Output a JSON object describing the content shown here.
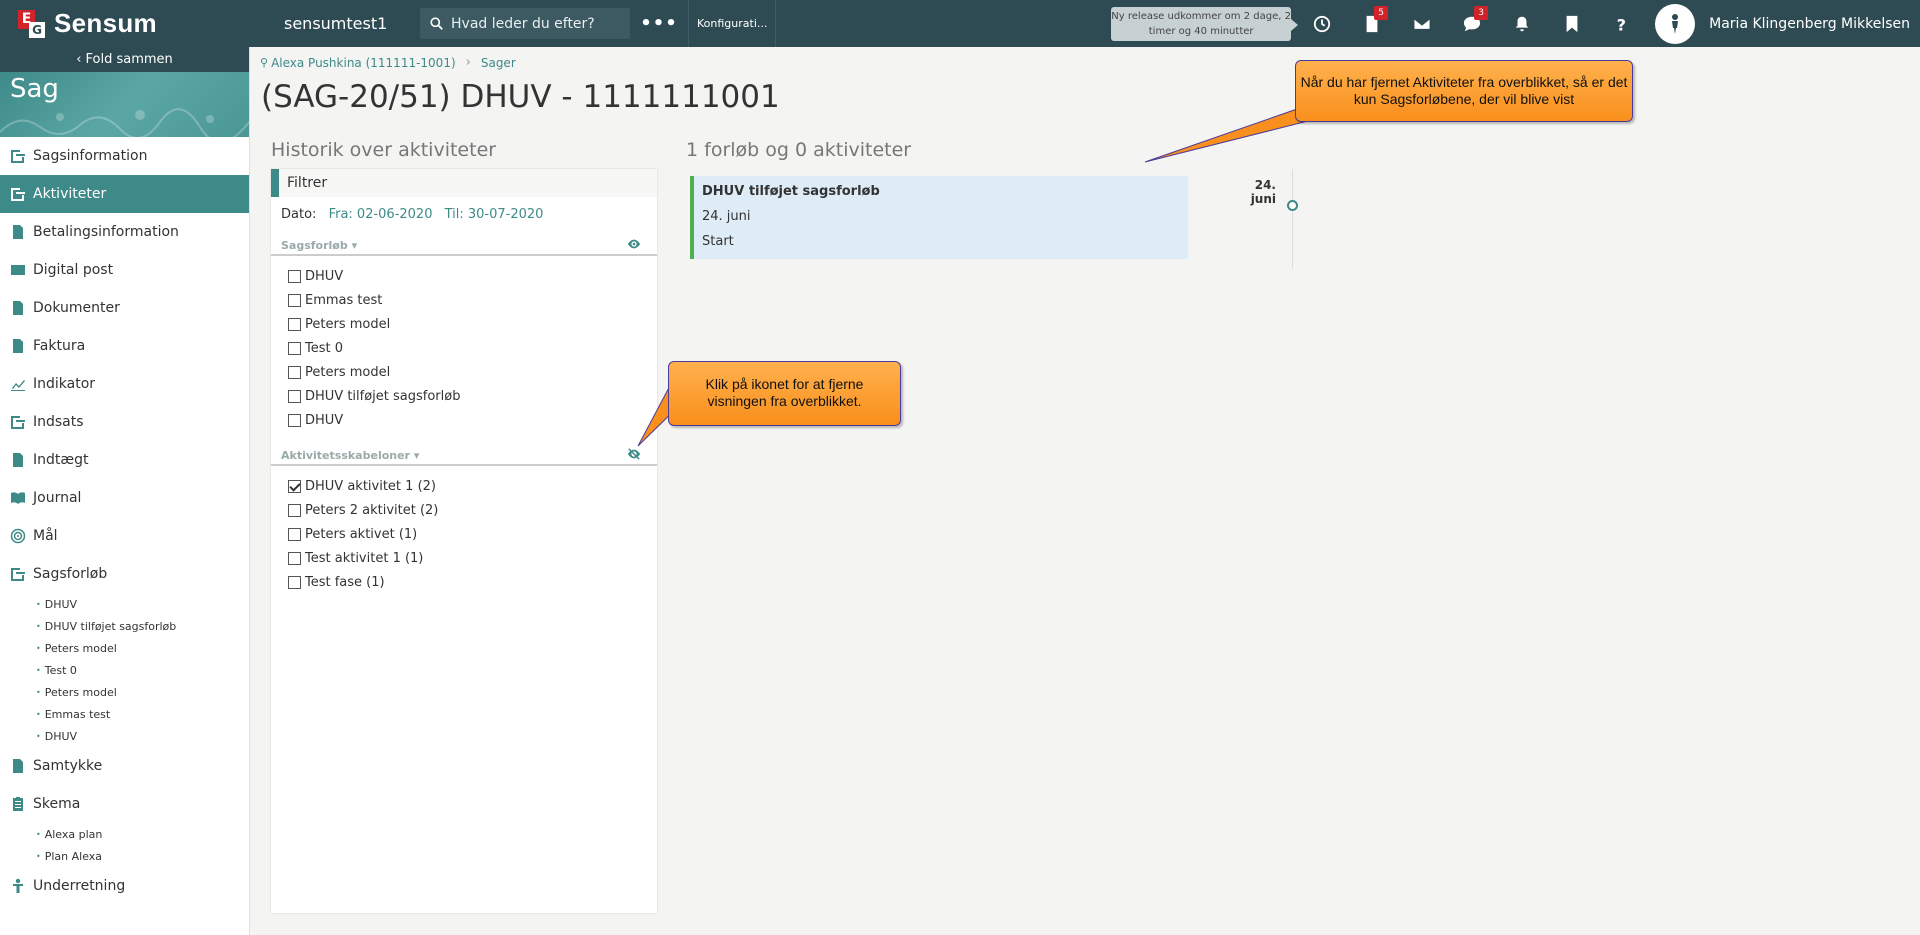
{
  "topbar": {
    "logo_e": "E",
    "logo_g": "G",
    "brand": "Sensum",
    "org": "sensumtest1",
    "search_placeholder": "Hvad leder du efter?",
    "more": "•••",
    "config": "Konfigurati...",
    "release": "Ny release udkommer om 2 dage, 2 timer og 40 minutter",
    "doc_badge": "5",
    "chat_badge": "3",
    "user": "Maria Klingenberg Mikkelsen"
  },
  "sidebar": {
    "fold": "Fold sammen",
    "title": "Sag",
    "items": [
      {
        "label": "Sagsinformation",
        "icon": "flow-icon"
      },
      {
        "label": "Aktiviteter",
        "icon": "flow-icon"
      },
      {
        "label": "Betalingsinformation",
        "icon": "document-icon"
      },
      {
        "label": "Digital post",
        "icon": "mail-icon"
      },
      {
        "label": "Dokumenter",
        "icon": "document-icon"
      },
      {
        "label": "Faktura",
        "icon": "document-icon"
      },
      {
        "label": "Indikator",
        "icon": "chart-icon"
      },
      {
        "label": "Indsats",
        "icon": "flow-icon"
      },
      {
        "label": "Indtægt",
        "icon": "document-icon"
      },
      {
        "label": "Journal",
        "icon": "book-icon"
      },
      {
        "label": "Mål",
        "icon": "target-icon"
      },
      {
        "label": "Sagsforløb",
        "icon": "flow-icon"
      },
      {
        "label": "Samtykke",
        "icon": "document-icon"
      },
      {
        "label": "Skema",
        "icon": "clipboard-icon"
      },
      {
        "label": "Underretning",
        "icon": "person-icon"
      }
    ],
    "sagsforlob_sub": [
      "DHUV",
      "DHUV tilføjet sagsforløb",
      "Peters model",
      "Test 0",
      "Peters model",
      "Emmas test",
      "DHUV"
    ],
    "skema_sub": [
      "Alexa plan",
      "Plan Alexa"
    ]
  },
  "breadcrumb": {
    "person": "Alexa Pushkina (111111-1001)",
    "sager": "Sager"
  },
  "page_title": "(SAG-20/51) DHUV - 1111111001",
  "history": {
    "title": "Historik over aktiviteter",
    "filter_label": "Filtrer",
    "dato_label": "Dato:",
    "fra": "Fra: 02-06-2020",
    "til": "Til: 30-07-2020",
    "sagsforlob_head": "Sagsforløb",
    "sagsforlob_items": [
      {
        "label": "DHUV",
        "checked": false
      },
      {
        "label": "Emmas test",
        "checked": false
      },
      {
        "label": "Peters model",
        "checked": false
      },
      {
        "label": "Test 0",
        "checked": false
      },
      {
        "label": "Peters model",
        "checked": false
      },
      {
        "label": "DHUV tilføjet sagsforløb",
        "checked": false
      },
      {
        "label": "DHUV",
        "checked": false
      }
    ],
    "skabeloner_head": "Aktivitetsskabeloner",
    "skabeloner_items": [
      {
        "label": "DHUV aktivitet 1 (2)",
        "checked": true
      },
      {
        "label": "Peters 2 aktivitet (2)",
        "checked": false
      },
      {
        "label": "Peters aktivet (1)",
        "checked": false
      },
      {
        "label": "Test aktivitet 1 (1)",
        "checked": false
      },
      {
        "label": "Test fase (1)",
        "checked": false
      }
    ]
  },
  "timeline": {
    "count_title": "1 forløb og 0 aktiviteter",
    "card_title": "DHUV tilføjet sagsforløb",
    "card_date": "24. juni",
    "card_status": "Start",
    "date_marker": "24. juni"
  },
  "callouts": {
    "top": "Når du har fjernet Aktiviteter fra overblikket, så er det kun Sagsforløbene, der vil blive vist",
    "middle": "Klik på ikonet for at fjerne visningen fra overblikket."
  },
  "colors": {
    "topbar": "#2e4a52",
    "accent": "#3d8a89",
    "callout": "#f98f1c",
    "badge": "#d2232a",
    "card": "#deecf7",
    "card_border": "#4caf50"
  }
}
